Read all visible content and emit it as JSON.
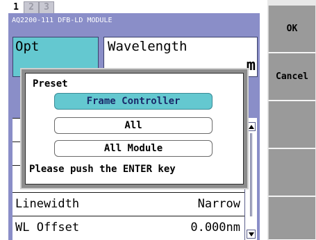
{
  "tabs": [
    {
      "label": "1",
      "active": true
    },
    {
      "label": "2",
      "active": false
    },
    {
      "label": "3",
      "active": false
    }
  ],
  "panel": {
    "module_title": "AQ2200-111 DFB-LD MODULE",
    "opt_label": "Opt",
    "wavelength_label": "Wavelength",
    "wavelength_unit": "m"
  },
  "list": {
    "rows": [
      {
        "name": "",
        "value": ""
      },
      {
        "name": "",
        "value": ""
      },
      {
        "name": "",
        "value": ""
      },
      {
        "name": "Linewidth",
        "value": "Narrow"
      },
      {
        "name": "WL Offset",
        "value": "0.000nm"
      }
    ]
  },
  "popup": {
    "title": "Preset",
    "options": [
      "Frame Controller",
      "All",
      "All Module"
    ],
    "selected": "Frame Controller",
    "message": "Please push the ENTER key"
  },
  "softkeys": {
    "ok": "OK",
    "cancel": "Cancel",
    "key3": "",
    "key4": "",
    "key5": ""
  },
  "colors": {
    "panel_bg": "#8a8ec8",
    "highlight": "#64c8d0",
    "softkey_bg": "#9a9a9a"
  }
}
